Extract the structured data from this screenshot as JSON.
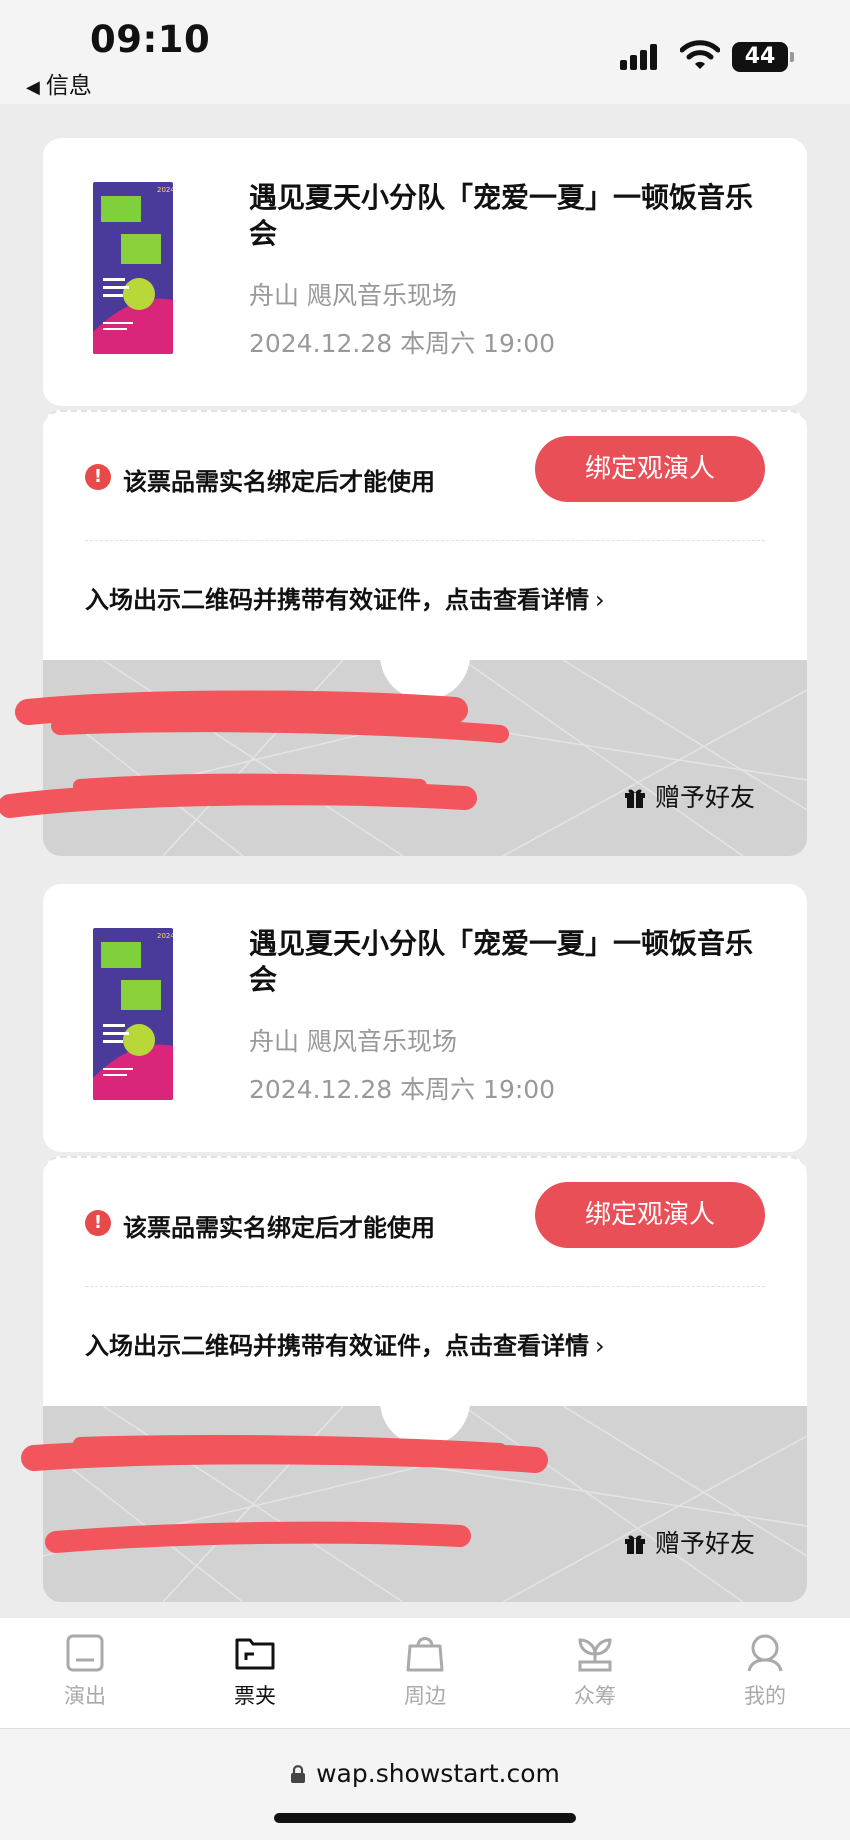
{
  "status_bar": {
    "time": "09:10",
    "back_app": "信息",
    "battery": "44"
  },
  "tickets": [
    {
      "title": "遇见夏天小分队「宠爱一夏」一顿饭音乐会",
      "venue": "舟山 飓风音乐现场",
      "datetime": "2024.12.28 本周六 19:00",
      "warning": "该票品需实名绑定后才能使用",
      "bind_button": "绑定观演人",
      "entry_tip": "入场出示二维码并携带有效证件，点击查看详情",
      "gift_label": "赠予好友"
    },
    {
      "title": "遇见夏天小分队「宠爱一夏」一顿饭音乐会",
      "venue": "舟山 飓风音乐现场",
      "datetime": "2024.12.28 本周六 19:00",
      "warning": "该票品需实名绑定后才能使用",
      "bind_button": "绑定观演人",
      "entry_tip": "入场出示二维码并携带有效证件，点击查看详情",
      "gift_label": "赠予好友"
    }
  ],
  "tabbar": {
    "items": [
      {
        "label": "演出",
        "icon": "shows-icon"
      },
      {
        "label": "票夹",
        "icon": "ticket-folder-icon",
        "active": true
      },
      {
        "label": "周边",
        "icon": "shopping-bag-icon"
      },
      {
        "label": "众筹",
        "icon": "sprout-icon"
      },
      {
        "label": "我的",
        "icon": "profile-icon"
      }
    ]
  },
  "browser": {
    "url": "wap.showstart.com"
  },
  "colors": {
    "accent": "#e84f57",
    "warning": "#e84a4a",
    "muted_text": "#999999",
    "ticket_stub": "#d2d2d2"
  }
}
